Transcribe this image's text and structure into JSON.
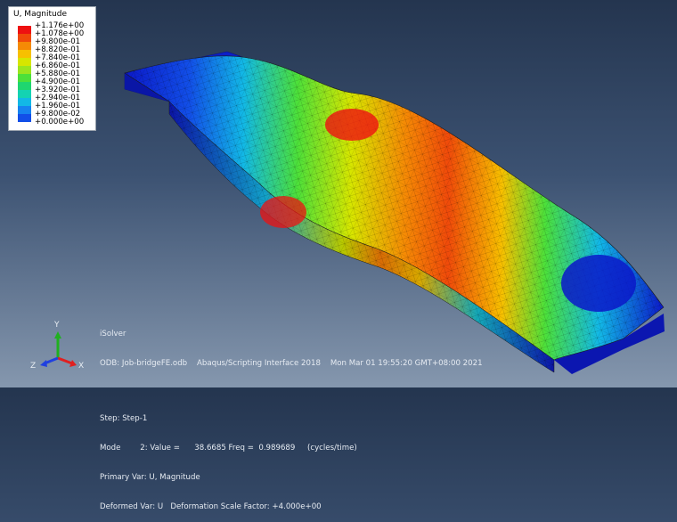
{
  "legend": {
    "title": "U, Magnitude",
    "labels": [
      "+1.176e+00",
      "+1.078e+00",
      "+9.800e-01",
      "+8.820e-01",
      "+7.840e-01",
      "+6.860e-01",
      "+5.880e-01",
      "+4.900e-01",
      "+3.920e-01",
      "+2.940e-01",
      "+1.960e-01",
      "+9.800e-02",
      "+0.000e+00"
    ],
    "colors": [
      "#ee1111",
      "#f04a0a",
      "#f58a05",
      "#f7c000",
      "#d7e600",
      "#9be51e",
      "#4ce03a",
      "#1fd66f",
      "#14d3b2",
      "#12b8e6",
      "#1683f0",
      "#124fe8",
      "#0b18c9"
    ]
  },
  "info": {
    "line1": "iSolver",
    "line2": "ODB: Job-bridgeFE.odb    Abaqus/Scripting Interface 2018    Mon Mar 01 19:55:20 GMT+08:00 2021",
    "line3": "Step: Step-1",
    "line4": "Mode        2: Value =      38.6685 Freq =  0.989689     (cycles/time)",
    "line5": "Primary Var: U, Magnitude",
    "line6": "Deformed Var: U   Deformation Scale Factor: +4.000e+00"
  },
  "triad": {
    "x": "X",
    "y": "Y",
    "z": "Z",
    "colors": {
      "x": "#e02020",
      "y": "#20b020",
      "z": "#2040e0"
    }
  }
}
